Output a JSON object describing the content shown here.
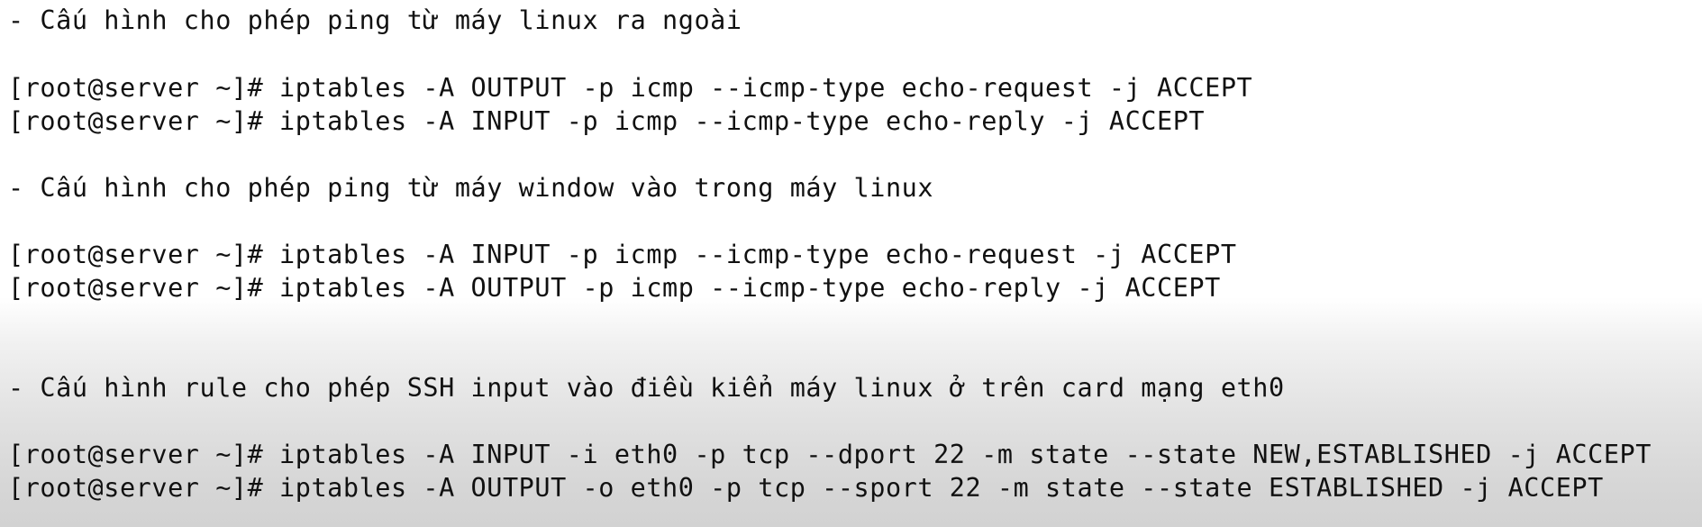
{
  "lines": [
    "- Cấu hình cho phép ping từ máy linux ra ngoài",
    "[root@server ~]# iptables -A OUTPUT -p icmp --icmp-type echo-request -j ACCEPT",
    "[root@server ~]# iptables -A INPUT -p icmp --icmp-type echo-reply -j ACCEPT",
    "- Cấu hình cho phép ping từ máy window vào trong máy linux",
    "[root@server ~]# iptables -A INPUT -p icmp --icmp-type echo-request -j ACCEPT",
    "[root@server ~]# iptables -A OUTPUT -p icmp --icmp-type echo-reply -j ACCEPT",
    "- Cấu hình rule cho phép SSH input vào điều kiển máy linux ở trên card mạng eth0",
    "[root@server ~]# iptables -A INPUT -i eth0 -p tcp --dport 22 -m state --state NEW,ESTABLISHED -j ACCEPT",
    "[root@server ~]# iptables -A OUTPUT -o eth0 -p tcp --sport 22 -m state --state ESTABLISHED -j ACCEPT"
  ]
}
